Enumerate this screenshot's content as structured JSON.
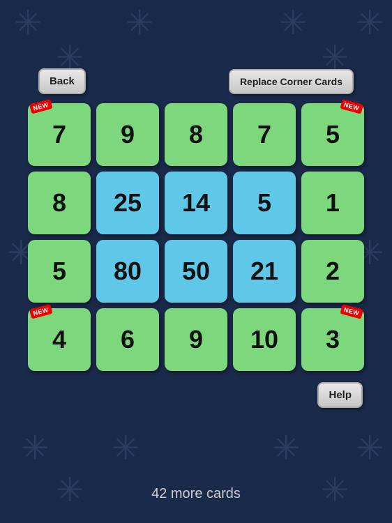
{
  "header": {
    "back_label": "Back",
    "replace_label": "Replace Corner Cards",
    "help_label": "Help"
  },
  "footer": {
    "more_cards": "42 more cards"
  },
  "grid": {
    "rows": [
      [
        {
          "value": "7",
          "color": "green",
          "badge": "new-left"
        },
        {
          "value": "9",
          "color": "green",
          "badge": null
        },
        {
          "value": "8",
          "color": "green",
          "badge": null
        },
        {
          "value": "7",
          "color": "green",
          "badge": null
        },
        {
          "value": "5",
          "color": "green",
          "badge": "new-right"
        }
      ],
      [
        {
          "value": "8",
          "color": "green",
          "badge": null
        },
        {
          "value": "25",
          "color": "blue",
          "badge": null
        },
        {
          "value": "14",
          "color": "blue",
          "badge": null
        },
        {
          "value": "5",
          "color": "blue",
          "badge": null
        },
        {
          "value": "1",
          "color": "green",
          "badge": null
        }
      ],
      [
        {
          "value": "5",
          "color": "green",
          "badge": null
        },
        {
          "value": "80",
          "color": "blue",
          "badge": null
        },
        {
          "value": "50",
          "color": "blue",
          "badge": null
        },
        {
          "value": "21",
          "color": "blue",
          "badge": null
        },
        {
          "value": "2",
          "color": "green",
          "badge": null
        }
      ],
      [
        {
          "value": "4",
          "color": "green",
          "badge": "new-left"
        },
        {
          "value": "6",
          "color": "green",
          "badge": null
        },
        {
          "value": "9",
          "color": "green",
          "badge": null
        },
        {
          "value": "10",
          "color": "green",
          "badge": null
        },
        {
          "value": "3",
          "color": "green",
          "badge": "new-right"
        }
      ]
    ]
  }
}
